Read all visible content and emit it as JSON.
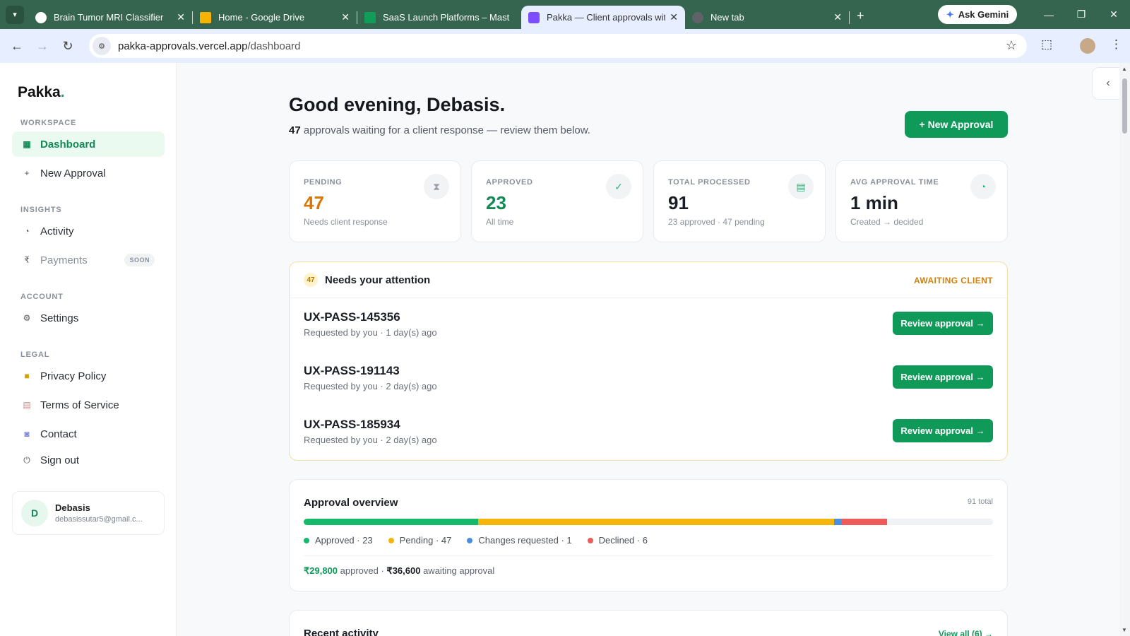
{
  "browser": {
    "tabs": [
      {
        "title": "Brain Tumor MRI Classifier",
        "icon": "chatgpt-icon",
        "color": "#ffffff"
      },
      {
        "title": "Home - Google Drive",
        "icon": "google-drive-icon",
        "color": "#f4b400"
      },
      {
        "title": "SaaS Launch Platforms – Mast",
        "icon": "google-sheets-icon",
        "color": "#0f9d58"
      },
      {
        "title": "Pakka — Client approvals wit",
        "icon": "pakka-icon",
        "color": "#7c4dff"
      },
      {
        "title": "New tab",
        "icon": "chrome-icon",
        "color": "#5f6368"
      }
    ],
    "gemini_label": "Ask Gemini",
    "url_host": "pakka-approvals.vercel.app",
    "url_path": "/dashboard"
  },
  "sidebar": {
    "logo": "Pakka",
    "logo_dot": ".",
    "sections": {
      "workspace": "WORKSPACE",
      "insights": "INSIGHTS",
      "account": "ACCOUNT",
      "legal": "LEGAL"
    },
    "items": {
      "dashboard": "Dashboard",
      "new_approval": "New Approval",
      "activity": "Activity",
      "payments": "Payments",
      "payments_badge": "SOON",
      "settings": "Settings",
      "privacy": "Privacy Policy",
      "terms": "Terms of Service",
      "contact": "Contact",
      "signout": "Sign out"
    },
    "user": {
      "initial": "D",
      "name": "Debasis",
      "email": "debasissutar5@gmail.c..."
    }
  },
  "main": {
    "greeting": "Good evening, Debasis.",
    "pending_count": "47",
    "subline_rest": " approvals waiting for a client response — review them below.",
    "new_button": "+ New Approval",
    "stats": [
      {
        "label": "PENDING",
        "value": "47",
        "note": "Needs client response",
        "color": "#d97706"
      },
      {
        "label": "APPROVED",
        "value": "23",
        "note": "All time",
        "color": "#138a55"
      },
      {
        "label": "TOTAL PROCESSED",
        "value": "91",
        "note": "23 approved · 47 pending",
        "color": "#14171c"
      },
      {
        "label": "AVG APPROVAL TIME",
        "value": "1 min",
        "note": "Created → decided",
        "color": "#14171c"
      }
    ],
    "attention": {
      "count": "47",
      "title": "Needs your attention",
      "status": "AWAITING CLIENT",
      "rows": [
        {
          "code": "UX-PASS-145356",
          "meta": "Requested by you · 1 day(s) ago",
          "action": "Review approval →"
        },
        {
          "code": "UX-PASS-191143",
          "meta": "Requested by you · 2 day(s) ago",
          "action": "Review approval →"
        },
        {
          "code": "UX-PASS-185934",
          "meta": "Requested by you · 2 day(s) ago",
          "action": "Review approval →"
        }
      ]
    },
    "overview": {
      "title": "Approval overview",
      "total": "91 total",
      "segments": [
        {
          "label": "Approved · 23",
          "value": 23,
          "color": "#16b86c"
        },
        {
          "label": "Pending · 47",
          "value": 47,
          "color": "#f5b50a"
        },
        {
          "label": "Changes requested · 1",
          "value": 1,
          "color": "#4a90e2"
        },
        {
          "label": "Declined · 6",
          "value": 6,
          "color": "#ef5b5b"
        }
      ],
      "bar_total": 91,
      "approved_amount": "₹29,800",
      "approved_text": " approved · ",
      "awaiting_amount": "₹36,600",
      "awaiting_text": " awaiting approval"
    },
    "recent": {
      "title": "Recent activity",
      "view_all": "View all (6) →"
    }
  }
}
